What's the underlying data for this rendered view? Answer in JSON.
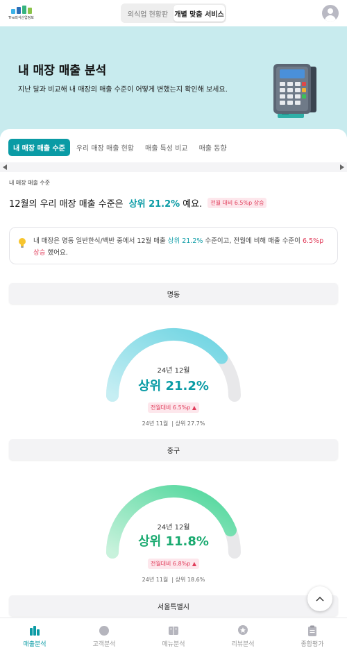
{
  "header": {
    "logo_text": "The외식산업정보",
    "segment": [
      "외식업 현황판",
      "개별 맞춤 서비스"
    ],
    "segment_active": 1
  },
  "hero": {
    "title": "내 매장 매출 분석",
    "subtitle": "지난 달과 비교해 내 매장의 매출 수준이 어떻게 변했는지 확인해 보세요."
  },
  "tabs": [
    "내 매장 매출 수준",
    "우리 매장 매출 현황",
    "매출 특성 비교",
    "매출 동향"
  ],
  "section": {
    "label": "내 매장 매출 수준",
    "headline_prefix": "12월의 우리 매장 매출 수준은",
    "headline_highlight": "상위 21.2%",
    "headline_suffix": "예요.",
    "badge": "전월 대비 6.5%p 상승"
  },
  "info": {
    "part1": "내 매장은 명동 일반한식/백반 중에서 12월 매출 ",
    "highlight": "상위 21.2%",
    "part2": " 수준이고, 전월에 비해 매출 수준이 ",
    "change": "6.5%p 상승",
    "part3": " 했어요."
  },
  "regions": [
    {
      "name": "명동",
      "month": "24년 12월",
      "value": "상위 21.2%",
      "change": "전월대비 6.5%p ▲",
      "prev_month": "24년 11월",
      "prev_value": "상위 27.7%",
      "fill": 0.788,
      "color_start": "#c6eef3",
      "color_end": "#6dd4e2",
      "value_color": "#0a9ba5"
    },
    {
      "name": "중구",
      "month": "24년 12월",
      "value": "상위 11.8%",
      "change": "전월대비 6.8%p ▲",
      "prev_month": "24년 11월",
      "prev_value": "상위 18.6%",
      "fill": 0.882,
      "color_start": "#c8f2dc",
      "color_end": "#4cd69a",
      "value_color": "#1aaa70"
    },
    {
      "name": "서울특별시"
    }
  ],
  "bottom_nav": [
    "매출분석",
    "고객분석",
    "메뉴분석",
    "리뷰분석",
    "종합평가"
  ],
  "bottom_nav_active": 0,
  "colors": {
    "accent": "#0a9ba5",
    "hero_bg": "#c8ebee",
    "alert": "#e03c5a"
  }
}
